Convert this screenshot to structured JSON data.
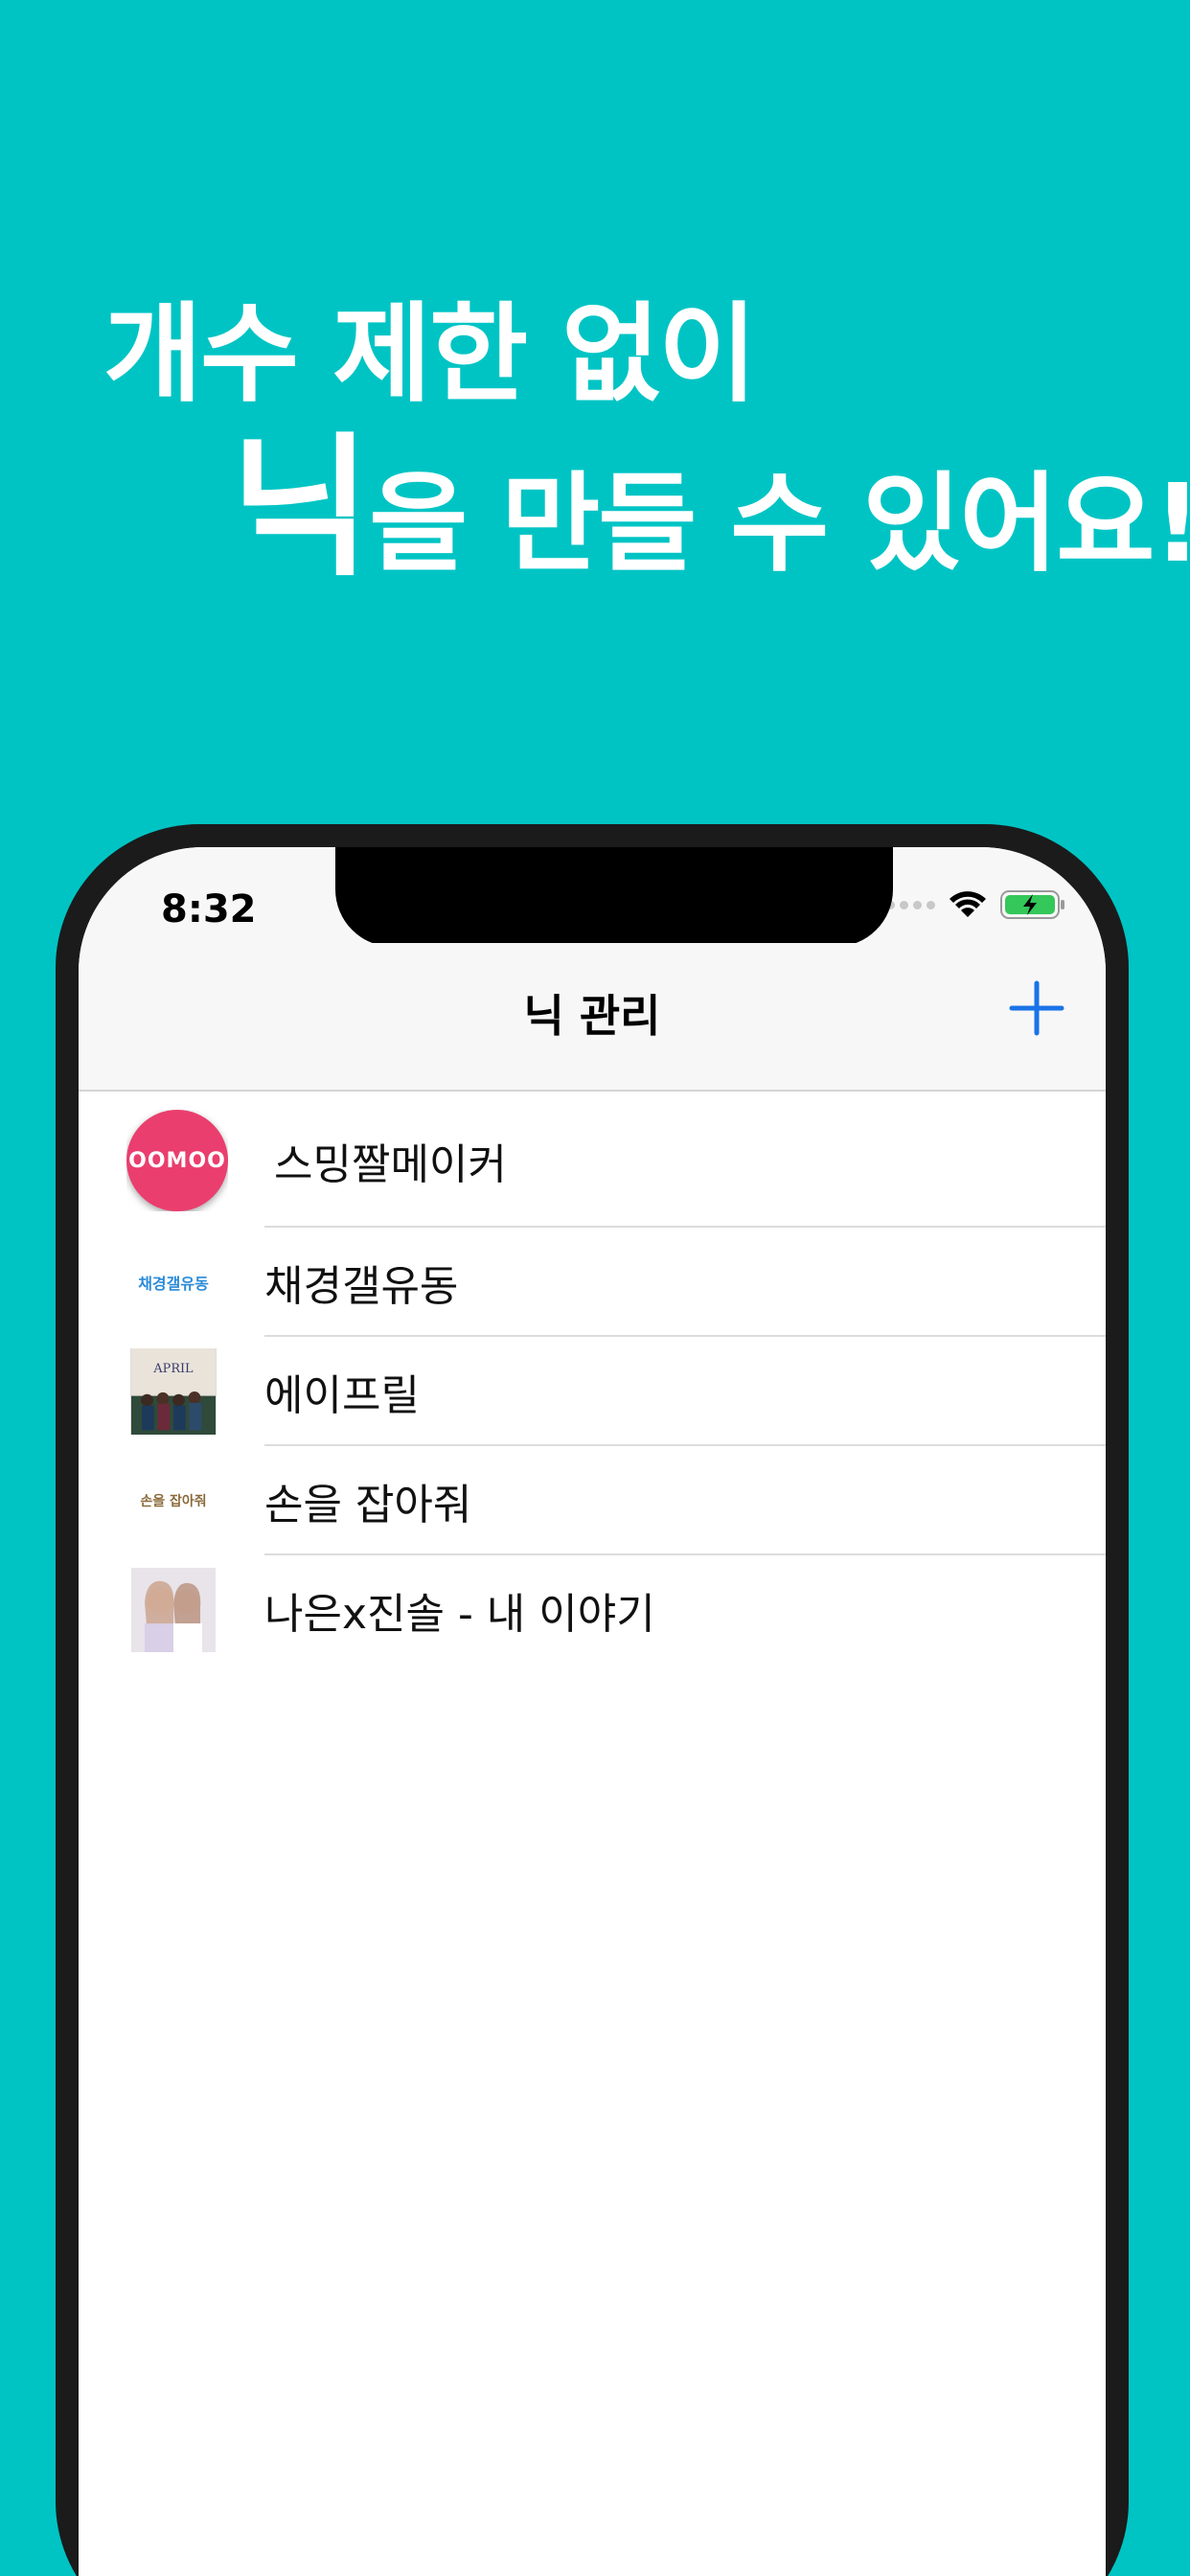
{
  "headline": {
    "line1": "개수 제한 없이",
    "line2_big": "닉",
    "line2_rest": "을 만들 수 있어요!"
  },
  "status": {
    "time": "8:32"
  },
  "nav": {
    "title": "닉 관리"
  },
  "items": [
    {
      "label": "스밍짤메이커",
      "thumb_text": "OOMOO"
    },
    {
      "label": "채경갤유동",
      "thumb_text": "채경갤유동"
    },
    {
      "label": "에이프릴",
      "thumb_text": "APRIL"
    },
    {
      "label": "손을 잡아줘",
      "thumb_text": "손을 잡아줘"
    },
    {
      "label": "나은x진솔 - 내 이야기"
    }
  ],
  "colors": {
    "background": "#00c4c4",
    "accent": "#1a73e8",
    "logo": "#ea3e6e"
  }
}
